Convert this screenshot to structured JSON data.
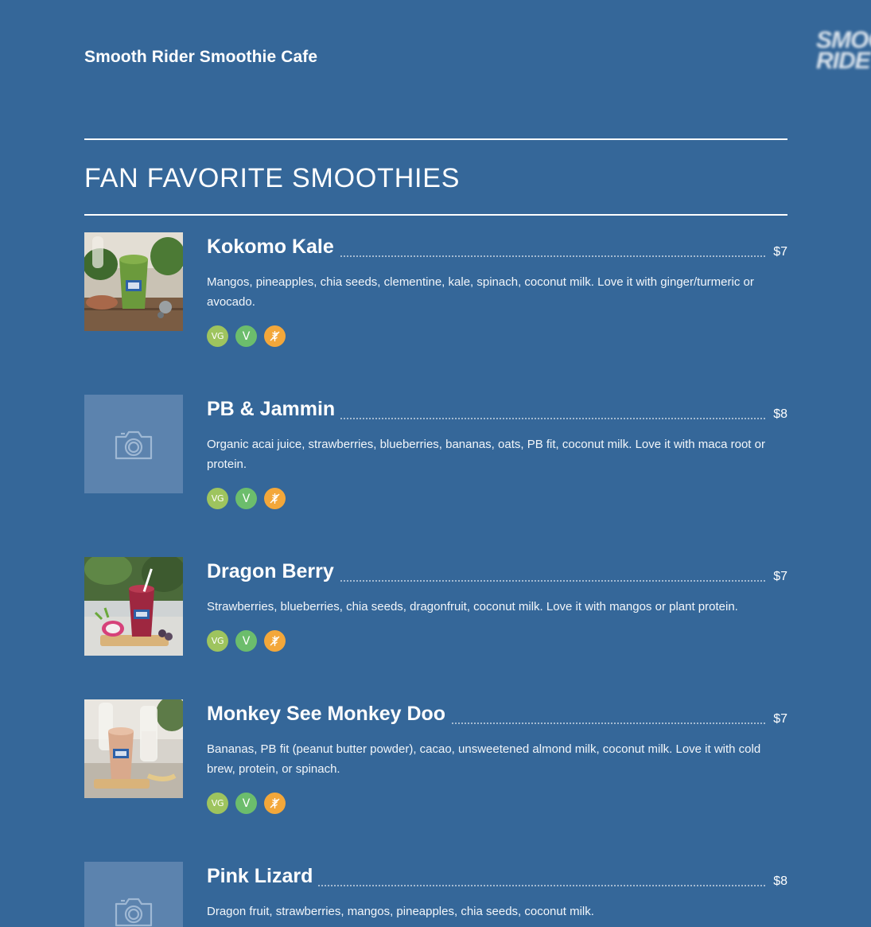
{
  "header": {
    "site_title": "Smooth Rider Smoothie Cafe",
    "logo_lines": [
      "SMOO",
      "RIDE"
    ]
  },
  "section": {
    "title": "FAN FAVORITE SMOOTHIES"
  },
  "badges": {
    "vegan_label": "VG",
    "vegetarian_label": "V",
    "gluten_free_icon": "wheat-crossed-icon"
  },
  "colors": {
    "background": "#356799",
    "vegan_badge": "#9ec45e",
    "vegetarian_badge": "#6cbd6c",
    "gluten_free_badge": "#f3a73a",
    "placeholder": "#5c83ae"
  },
  "items": [
    {
      "name": "Kokomo Kale",
      "price": "$7",
      "description": "Mangos, pineapples, chia seeds, clementine, kale, spinach, coconut milk. Love it with ginger/turmeric or avocado.",
      "image": "green-smoothie-photo"
    },
    {
      "name": "PB & Jammin",
      "price": "$8",
      "description": "Organic acai juice, strawberries, blueberries, bananas, oats, PB fit, coconut milk. Love it with maca root or protein.",
      "image": "camera-placeholder-icon"
    },
    {
      "name": "Dragon Berry",
      "price": "$7",
      "description": "Strawberries, blueberries, chia seeds, dragonfruit, coconut milk. Love it with mangos or plant protein.",
      "image": "berry-smoothie-photo"
    },
    {
      "name": "Monkey See Monkey Doo",
      "price": "$7",
      "description": "Bananas, PB fit (peanut butter powder), cacao, unsweetened almond milk, coconut milk. Love it with cold brew, protein, or spinach.",
      "image": "banana-smoothie-photo"
    },
    {
      "name": "Pink Lizard",
      "price": "$8",
      "description": "Dragon fruit, strawberries, mangos, pineapples, chia seeds, coconut milk.",
      "image": "camera-placeholder-icon"
    }
  ]
}
